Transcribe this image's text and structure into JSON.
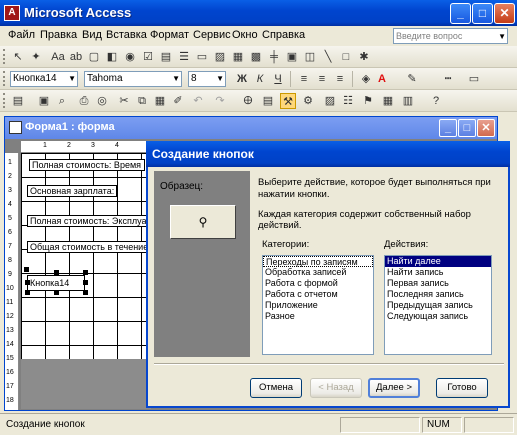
{
  "app": {
    "title": "Microsoft Access"
  },
  "window_buttons": {
    "minimize": "_",
    "maximize": "□",
    "close": "✕"
  },
  "menu": {
    "items": [
      "Файл",
      "Правка",
      "Вид",
      "Вставка",
      "Формат",
      "Сервис",
      "Окно",
      "Справка"
    ],
    "search_placeholder": "Введите вопрос"
  },
  "format_toolbar": {
    "control_name": "Кнопка14",
    "font_name": "Tahoma",
    "font_size": "8",
    "bold": "Ж",
    "italic": "К",
    "underline": "Ч"
  },
  "form_window": {
    "title": "Форма1 : форма",
    "ruler_top": [
      "1",
      "2",
      "3",
      "4"
    ],
    "ruler_left": [
      "1",
      "2",
      "3",
      "4",
      "5",
      "6",
      "7",
      "8",
      "9",
      "10",
      "11",
      "12",
      "13",
      "14",
      "15",
      "16",
      "17",
      "18"
    ],
    "controls": [
      {
        "text": "Полная стоимость: Время"
      },
      {
        "text": "Основная зарплата:"
      },
      {
        "text": "Полная стоимость: Эксплуатация"
      },
      {
        "text": "Общая стоимость в течение срока"
      },
      {
        "text": "Кнопка14"
      }
    ]
  },
  "dialog": {
    "title": "Создание кнопок",
    "sample_label": "Образец:",
    "instruction": "Выберите действие, которое будет выполняться при нажатии кнопки.",
    "instruction2": "Каждая категория содержит собственный набор действий.",
    "categories_label": "Категории:",
    "actions_label": "Действия:",
    "categories": [
      "Переходы по записям",
      "Обработка записей",
      "Работа с формой",
      "Работа с отчетом",
      "Приложение",
      "Разное"
    ],
    "actions": [
      "Найти далее",
      "Найти запись",
      "Первая запись",
      "Последняя запись",
      "Предыдущая запись",
      "Следующая запись"
    ],
    "buttons": {
      "cancel": "Отмена",
      "back": "< Назад",
      "next": "Далее >",
      "finish": "Готово"
    }
  },
  "status": {
    "text": "Создание кнопок",
    "num": "NUM"
  }
}
